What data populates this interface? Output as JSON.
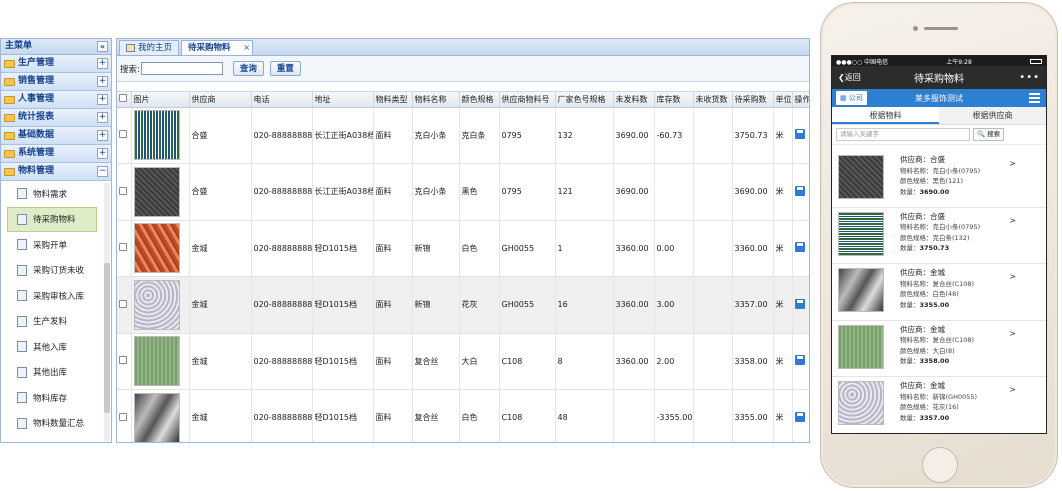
{
  "sidebar": {
    "header": "主菜单",
    "collapse": "«",
    "groups": [
      {
        "label": "生产管理",
        "toggle": "+"
      },
      {
        "label": "销售管理",
        "toggle": "+"
      },
      {
        "label": "人事管理",
        "toggle": "+"
      },
      {
        "label": "统计报表",
        "toggle": "+"
      },
      {
        "label": "基础数据",
        "toggle": "+"
      },
      {
        "label": "系统管理",
        "toggle": "+"
      },
      {
        "label": "物料管理",
        "toggle": "−"
      }
    ],
    "items": [
      "物料需求",
      "待采购物料",
      "采购开单",
      "采购订货未收",
      "采购审核入库",
      "生产发料",
      "其他入库",
      "其他出库",
      "物料库存",
      "物料数量汇总"
    ]
  },
  "tabs": {
    "home": "我的主页",
    "current": "待采购物料",
    "close": "×"
  },
  "search": {
    "label": "搜索:",
    "value": "",
    "query_btn": "查询",
    "reset_btn": "重置"
  },
  "grid": {
    "headers": [
      "图片",
      "供应商",
      "电话",
      "地址",
      "物料类型",
      "物料名称",
      "颜色规格",
      "供应商物料号",
      "厂家色号规格",
      "未发料数",
      "库存数",
      "未收货数",
      "待采购数",
      "单位",
      "操作"
    ],
    "rows": [
      {
        "swatch": "sw-green-check",
        "supplier": "合盛",
        "phone": "020-88888888",
        "address": "长江正街A038档",
        "type": "面料",
        "name": "克白小条",
        "color": "克白条",
        "sup_code": "0795",
        "factory_code": "132",
        "unissued": "3690.00",
        "stock": "-60.73",
        "unreceived": "",
        "to_buy": "3750.73",
        "unit": "米"
      },
      {
        "swatch": "sw-dark",
        "supplier": "合盛",
        "phone": "020-88888888",
        "address": "长江正街A038档",
        "type": "面料",
        "name": "克白小条",
        "color": "黑色",
        "sup_code": "0795",
        "factory_code": "121",
        "unissued": "3690.00",
        "stock": "",
        "unreceived": "",
        "to_buy": "3690.00",
        "unit": "米"
      },
      {
        "swatch": "sw-red",
        "supplier": "金城",
        "phone": "020-88888888",
        "address": "轻D1015档",
        "type": "面料",
        "name": "新锦",
        "color": "白色",
        "sup_code": "GH0055",
        "factory_code": "1",
        "unissued": "3360.00",
        "stock": "0.00",
        "unreceived": "",
        "to_buy": "3360.00",
        "unit": "米"
      },
      {
        "swatch": "sw-gray",
        "supplier": "金城",
        "phone": "020-88888888",
        "address": "轻D1015档",
        "type": "面料",
        "name": "新锦",
        "color": "花灰",
        "sup_code": "GH0055",
        "factory_code": "16",
        "unissued": "3360.00",
        "stock": "3.00",
        "unreceived": "",
        "to_buy": "3357.00",
        "unit": "米"
      },
      {
        "swatch": "sw-olive",
        "supplier": "金城",
        "phone": "020-88888888",
        "address": "轻D1015档",
        "type": "面料",
        "name": "复合丝",
        "color": "大白",
        "sup_code": "C108",
        "factory_code": "8",
        "unissued": "3360.00",
        "stock": "2.00",
        "unreceived": "",
        "to_buy": "3358.00",
        "unit": "米"
      },
      {
        "swatch": "sw-satin",
        "supplier": "金城",
        "phone": "020-88888888",
        "address": "轻D1015档",
        "type": "面料",
        "name": "复合丝",
        "color": "白色",
        "sup_code": "C108",
        "factory_code": "48",
        "unissued": "",
        "stock": "-3355.00",
        "unreceived": "",
        "to_buy": "3355.00",
        "unit": "米"
      }
    ]
  },
  "phone": {
    "status_left": "●●●○○ 中国电信 ",
    "status_time": "上午9:28",
    "status_right": "",
    "back": "❮返回",
    "title": "待采购物料",
    "more": "•••",
    "company_btn": "▦ 公司",
    "company_name": "莱多服饰测试",
    "tab_material": "根据物料",
    "tab_supplier": "根据供应商",
    "search_placeholder": "请输入关键字",
    "search_btn": "🔍 搜索",
    "cards": [
      {
        "swatch": "sw-dark",
        "supplier": "供应商：合盛",
        "name": "物料名称：克白小条(0795)",
        "color": "颜色规格：黑色(121)",
        "qty_label": "数量：",
        "qty": "3690.00"
      },
      {
        "swatch": "sw-green-check2",
        "supplier": "供应商：合盛",
        "name": "物料名称：克白小条(0795)",
        "color": "颜色规格：克白条(132)",
        "qty_label": "数量：",
        "qty": "3750.73"
      },
      {
        "swatch": "sw-satin",
        "supplier": "供应商：金城",
        "name": "物料名称：复合丝(C108)",
        "color": "颜色规格：白色(48)",
        "qty_label": "数量：",
        "qty": "3355.00"
      },
      {
        "swatch": "sw-olive",
        "supplier": "供应商：金城",
        "name": "物料名称：复合丝(C108)",
        "color": "颜色规格：大白(8)",
        "qty_label": "数量：",
        "qty": "3358.00"
      },
      {
        "swatch": "sw-gray",
        "supplier": "供应商：金城",
        "name": "物料名称：新锦(GH0055)",
        "color": "颜色规格：花灰(16)",
        "qty_label": "数量：",
        "qty": "3357.00"
      }
    ],
    "chevron": ">"
  }
}
